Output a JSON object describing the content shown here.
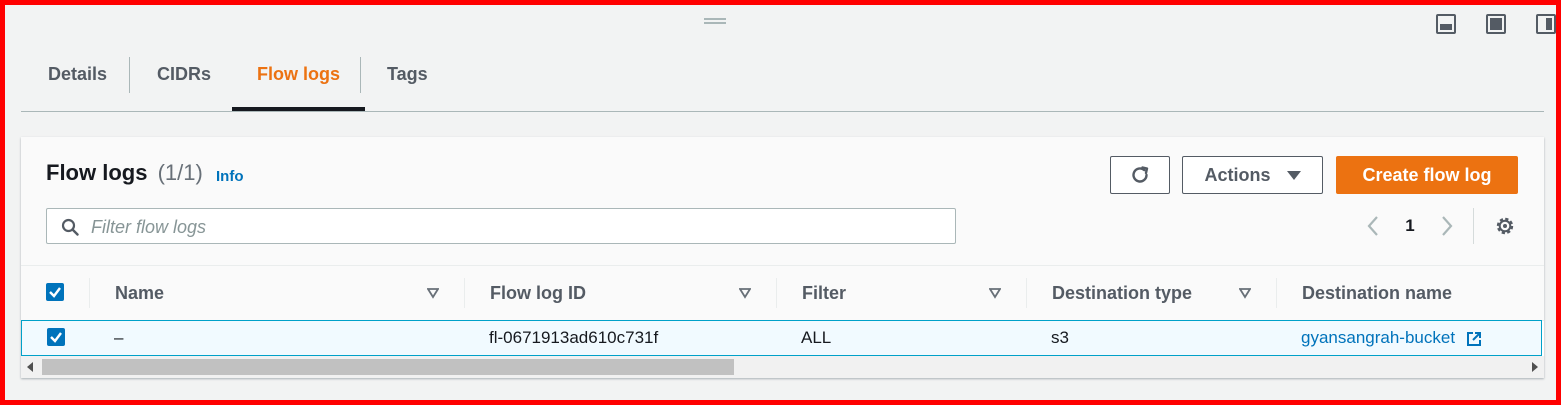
{
  "tabs": [
    {
      "label": "Details",
      "active": false
    },
    {
      "label": "CIDRs",
      "active": false
    },
    {
      "label": "Flow logs",
      "active": true
    },
    {
      "label": "Tags",
      "active": false
    }
  ],
  "panel": {
    "title": "Flow logs",
    "count": "(1/1)",
    "info_label": "Info",
    "actions_label": "Actions",
    "create_label": "Create flow log",
    "refresh_icon": "refresh-icon",
    "search": {
      "placeholder": "Filter flow logs",
      "value": ""
    },
    "pagination": {
      "page": "1"
    }
  },
  "table": {
    "columns": [
      "Name",
      "Flow log ID",
      "Filter",
      "Destination type",
      "Destination name"
    ],
    "rows": [
      {
        "selected": true,
        "name": "–",
        "flow_log_id": "fl-0671913ad610c731f",
        "filter": "ALL",
        "destination_type": "s3",
        "destination_name": "gyansangrah-bucket"
      }
    ],
    "select_all": true
  },
  "colors": {
    "accent": "#ec7211",
    "link": "#0073bb",
    "selected_row_border": "#00a1c9",
    "frame_border": "#ff0000"
  }
}
